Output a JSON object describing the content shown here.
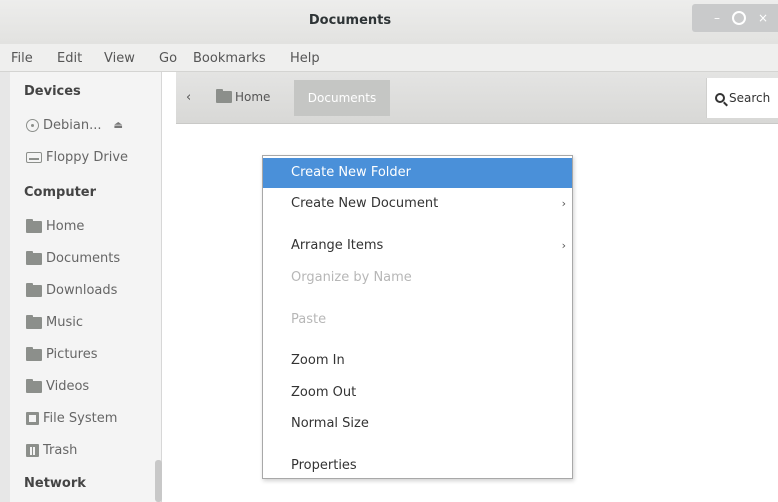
{
  "window": {
    "title": "Documents",
    "controls": {
      "minimize": "–",
      "close": "×"
    }
  },
  "menubar": [
    "File",
    "Edit",
    "View",
    "Go",
    "Bookmarks",
    "Help"
  ],
  "sidebar": {
    "devices_heading": "Devices",
    "devices": [
      {
        "label": "Debian...",
        "icon": "disc-icon"
      },
      {
        "label": "Floppy Drive",
        "icon": "drive-icon"
      }
    ],
    "eject": "⏏",
    "computer_heading": "Computer",
    "computer": [
      {
        "label": "Home",
        "icon": "folder-icon"
      },
      {
        "label": "Documents",
        "icon": "folder-icon"
      },
      {
        "label": "Downloads",
        "icon": "folder-icon"
      },
      {
        "label": "Music",
        "icon": "folder-icon"
      },
      {
        "label": "Pictures",
        "icon": "folder-icon"
      },
      {
        "label": "Videos",
        "icon": "folder-icon"
      },
      {
        "label": "File System",
        "icon": "filesystem-icon"
      },
      {
        "label": "Trash",
        "icon": "trash-icon"
      }
    ],
    "network_heading": "Network"
  },
  "pathbar": {
    "back": "‹",
    "home": "Home",
    "current": "Documents"
  },
  "search": {
    "label": "Search"
  },
  "context_menu": {
    "items": [
      {
        "label": "Create New Folder",
        "state": "highlighted"
      },
      {
        "label": "Create New Document",
        "submenu": "›"
      },
      {
        "label": "Arrange Items",
        "submenu": "›"
      },
      {
        "label": "Organize by Name",
        "state": "disabled"
      },
      {
        "label": "Paste",
        "state": "disabled"
      },
      {
        "label": "Zoom In"
      },
      {
        "label": "Zoom Out"
      },
      {
        "label": "Normal Size"
      },
      {
        "label": "Properties"
      }
    ]
  },
  "colors": {
    "highlight": "#4a90d9",
    "sidebar_bg": "#f4f4f4",
    "titlebar_bg": "#ededec"
  }
}
